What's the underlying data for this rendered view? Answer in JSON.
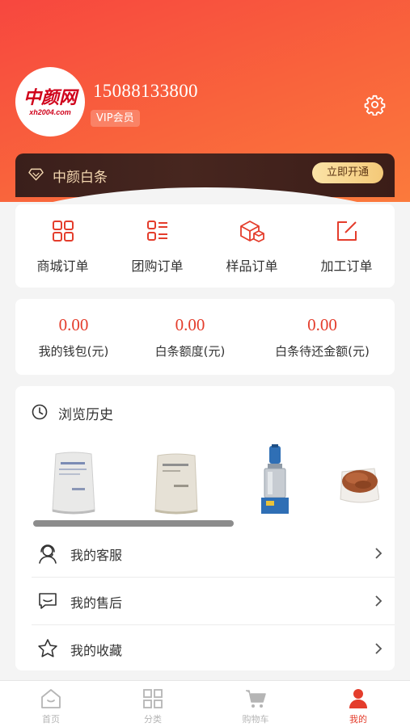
{
  "profile": {
    "avatar_logo": "中颜网",
    "avatar_sub": "xh2004.com",
    "phone": "15088133800",
    "member_badge": "VIP会员"
  },
  "baitiao": {
    "title": "中颜白条",
    "open_button": "立即开通"
  },
  "orders": [
    {
      "label": "商城订单",
      "icon": "grid-icon"
    },
    {
      "label": "团购订单",
      "icon": "list-icon"
    },
    {
      "label": "样品订单",
      "icon": "box-icon"
    },
    {
      "label": "加工订单",
      "icon": "edit-icon"
    }
  ],
  "wallet": [
    {
      "value": "0.00",
      "label": "我的钱包(元)"
    },
    {
      "value": "0.00",
      "label": "白条额度(元)"
    },
    {
      "value": "0.00",
      "label": "白条待还金额(元)"
    }
  ],
  "history": {
    "title": "浏览历史",
    "products": [
      {
        "icon": "resin-bag-image"
      },
      {
        "icon": "resin-bag-image"
      },
      {
        "icon": "mixer-machine-image"
      },
      {
        "icon": "granules-bowl-image"
      }
    ]
  },
  "menu": [
    {
      "label": "我的客服",
      "icon": "customer-service-icon"
    },
    {
      "label": "我的售后",
      "icon": "chat-bubble-icon"
    },
    {
      "label": "我的收藏",
      "icon": "star-icon"
    }
  ],
  "tabs": [
    {
      "label": "首页",
      "icon": "home-icon"
    },
    {
      "label": "分类",
      "icon": "category-icon"
    },
    {
      "label": "购物车",
      "icon": "cart-icon"
    },
    {
      "label": "我的",
      "icon": "user-icon"
    }
  ],
  "colors": {
    "brand_red": "#e43d2c",
    "header_gradient_start": "#f7473f",
    "header_gradient_end": "#fb7a3c",
    "card_dark": "#3a1f1b",
    "gold": "#f4c978"
  }
}
